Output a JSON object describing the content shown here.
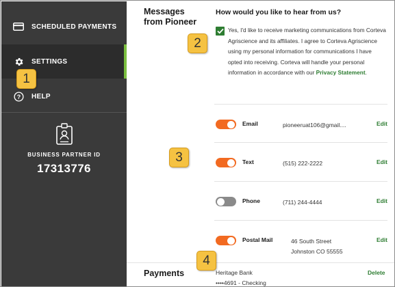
{
  "sidebar": {
    "items": [
      {
        "label": "SCHEDULED PAYMENTS",
        "icon": "credit-card-icon"
      },
      {
        "label": "SETTINGS",
        "icon": "gear-icon",
        "active": true
      },
      {
        "label": "HELP",
        "icon": "question-circle-icon"
      }
    ],
    "business_partner": {
      "label": "BUSINESS PARTNER ID",
      "value": "17313776",
      "icon": "id-badge-icon"
    }
  },
  "messages": {
    "section_title_line1": "Messages",
    "section_title_line2": "from Pioneer",
    "question": "How would you like to hear from us?",
    "consent": {
      "checked": true,
      "text": "Yes, I'd like to receive marketing communications from Corteva Agriscience and its affiliates. I agree to Corteva Agriscience using my personal information for communications I have opted into receiving. Corteva will handle your personal information in accordance with our ",
      "link_label": "Privacy Statement",
      "tail": "."
    },
    "preferences": [
      {
        "name": "Email",
        "value": "pioneeruat106@gmail....",
        "value2": "",
        "enabled": true,
        "edit_label": "Edit"
      },
      {
        "name": "Text",
        "value": "(515) 222-2222",
        "value2": "",
        "enabled": true,
        "edit_label": "Edit"
      },
      {
        "name": "Phone",
        "value": "(711) 244-4444",
        "value2": "",
        "enabled": false,
        "edit_label": "Edit"
      },
      {
        "name": "Postal Mail",
        "value": "46 South Street",
        "value2": "Johnston CO 55555",
        "enabled": true,
        "edit_label": "Edit"
      }
    ]
  },
  "payments": {
    "section_title": "Payments",
    "bank": "Heritage Bank",
    "account": "••••4691 - Checking",
    "delete_label": "Delete"
  },
  "callouts": [
    "1",
    "2",
    "3",
    "4"
  ],
  "colors": {
    "sidebar_bg": "#3a3a3a",
    "active_accent": "#7bbf3f",
    "link_green": "#2e7d32",
    "toggle_on": "#f26a21",
    "toggle_off": "#8a8a8a",
    "callout_fill": "#f5c242"
  }
}
